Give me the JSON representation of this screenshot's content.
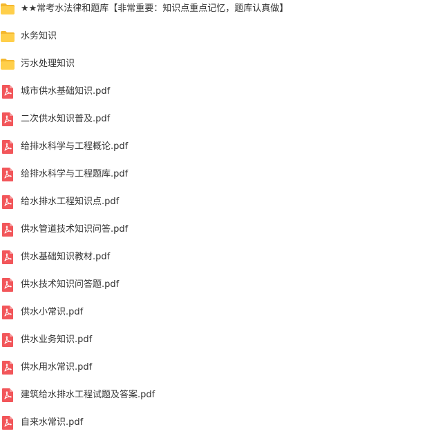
{
  "colors": {
    "folder": "#FFCF4A",
    "folder_back": "#F5B82E",
    "pdf": "#F2565A",
    "text": "#333333"
  },
  "files": [
    {
      "type": "folder",
      "icon": "folder-icon",
      "name": "★★常考水法律和题库【非常重要：知识点重点记忆，题库认真做】"
    },
    {
      "type": "folder",
      "icon": "folder-icon",
      "name": "水务知识"
    },
    {
      "type": "folder",
      "icon": "folder-icon",
      "name": "污水处理知识"
    },
    {
      "type": "pdf",
      "icon": "pdf-icon",
      "name": "城市供水基础知识.pdf"
    },
    {
      "type": "pdf",
      "icon": "pdf-icon",
      "name": "二次供水知识普及.pdf"
    },
    {
      "type": "pdf",
      "icon": "pdf-icon",
      "name": "给排水科学与工程概论.pdf"
    },
    {
      "type": "pdf",
      "icon": "pdf-icon",
      "name": "给排水科学与工程题库.pdf"
    },
    {
      "type": "pdf",
      "icon": "pdf-icon",
      "name": "给水排水工程知识点.pdf"
    },
    {
      "type": "pdf",
      "icon": "pdf-icon",
      "name": "供水管道技术知识问答.pdf"
    },
    {
      "type": "pdf",
      "icon": "pdf-icon",
      "name": "供水基础知识教材.pdf"
    },
    {
      "type": "pdf",
      "icon": "pdf-icon",
      "name": "供水技术知识问答题.pdf"
    },
    {
      "type": "pdf",
      "icon": "pdf-icon",
      "name": "供水小常识.pdf"
    },
    {
      "type": "pdf",
      "icon": "pdf-icon",
      "name": "供水业务知识.pdf"
    },
    {
      "type": "pdf",
      "icon": "pdf-icon",
      "name": "供水用水常识.pdf"
    },
    {
      "type": "pdf",
      "icon": "pdf-icon",
      "name": "建筑给水排水工程试题及答案.pdf"
    },
    {
      "type": "pdf",
      "icon": "pdf-icon",
      "name": "自来水常识.pdf"
    }
  ]
}
